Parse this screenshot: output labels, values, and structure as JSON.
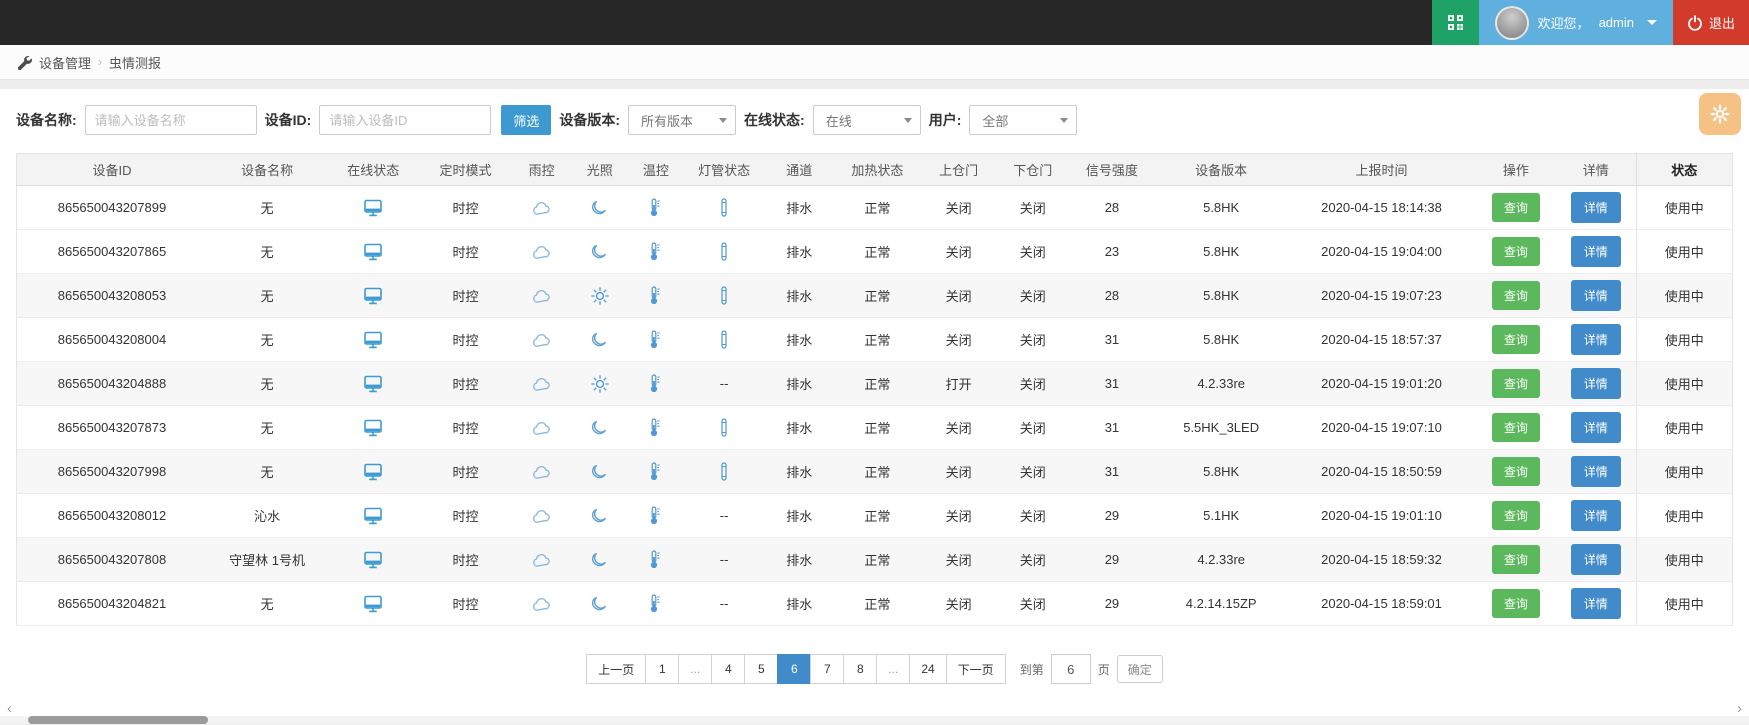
{
  "topbar": {
    "welcome_prefix": "欢迎您，",
    "username": "admin",
    "logout_label": "退出"
  },
  "breadcrumb": {
    "items": [
      "设备管理",
      "虫情测报"
    ],
    "separator": "›"
  },
  "filters": {
    "device_name_label": "设备名称:",
    "device_name_placeholder": "请输入设备名称",
    "device_id_label": "设备ID:",
    "device_id_placeholder": "请输入设备ID",
    "filter_button_label": "筛选",
    "version_label": "设备版本:",
    "version_value": "所有版本",
    "online_label": "在线状态:",
    "online_value": "在线",
    "user_label": "用户:",
    "user_value": "全部"
  },
  "table": {
    "headers": [
      "设备ID",
      "设备名称",
      "在线状态",
      "定时模式",
      "雨控",
      "光照",
      "温控",
      "灯管状态",
      "通道",
      "加热状态",
      "上仓门",
      "下仓门",
      "信号强度",
      "设备版本",
      "上报时间",
      "操作",
      "详情",
      "状态"
    ],
    "rows": [
      {
        "device_id": "865650043207899",
        "name": "无",
        "online": "monitor-icon",
        "timer_mode": "时控",
        "rain": "cloud-icon",
        "light": "moon-icon",
        "temp": "thermometer-icon",
        "tube": "tube-icon",
        "channel": "排水",
        "heating": "正常",
        "upper_door": "关闭",
        "lower_door": "关闭",
        "signal": "28",
        "version": "5.8HK",
        "report_time": "2020-04-15 18:14:38",
        "query": "查询",
        "detail": "详情",
        "status": "使用中"
      },
      {
        "device_id": "865650043207865",
        "name": "无",
        "online": "monitor-icon",
        "timer_mode": "时控",
        "rain": "cloud-icon",
        "light": "moon-icon",
        "temp": "thermometer-icon",
        "tube": "tube-icon",
        "channel": "排水",
        "heating": "正常",
        "upper_door": "关闭",
        "lower_door": "关闭",
        "signal": "23",
        "version": "5.8HK",
        "report_time": "2020-04-15 19:04:00",
        "query": "查询",
        "detail": "详情",
        "status": "使用中"
      },
      {
        "device_id": "865650043208053",
        "name": "无",
        "online": "monitor-icon",
        "timer_mode": "时控",
        "rain": "cloud-icon",
        "light": "sun-icon",
        "temp": "thermometer-icon",
        "tube": "tube-icon",
        "channel": "排水",
        "heating": "正常",
        "upper_door": "关闭",
        "lower_door": "关闭",
        "signal": "28",
        "version": "5.8HK",
        "report_time": "2020-04-15 19:07:23",
        "query": "查询",
        "detail": "详情",
        "status": "使用中"
      },
      {
        "device_id": "865650043208004",
        "name": "无",
        "online": "monitor-icon",
        "timer_mode": "时控",
        "rain": "cloud-icon",
        "light": "moon-icon",
        "temp": "thermometer-icon",
        "tube": "tube-icon",
        "channel": "排水",
        "heating": "正常",
        "upper_door": "关闭",
        "lower_door": "关闭",
        "signal": "31",
        "version": "5.8HK",
        "report_time": "2020-04-15 18:57:37",
        "query": "查询",
        "detail": "详情",
        "status": "使用中"
      },
      {
        "device_id": "865650043204888",
        "name": "无",
        "online": "monitor-icon",
        "timer_mode": "时控",
        "rain": "cloud-icon",
        "light": "sun-icon",
        "temp": "thermometer-icon",
        "tube": "--",
        "channel": "排水",
        "heating": "正常",
        "upper_door": "打开",
        "lower_door": "关闭",
        "signal": "31",
        "version": "4.2.33re",
        "report_time": "2020-04-15 19:01:20",
        "query": "查询",
        "detail": "详情",
        "status": "使用中"
      },
      {
        "device_id": "865650043207873",
        "name": "无",
        "online": "monitor-icon",
        "timer_mode": "时控",
        "rain": "cloud-icon",
        "light": "moon-icon",
        "temp": "thermometer-icon",
        "tube": "tube-icon",
        "channel": "排水",
        "heating": "正常",
        "upper_door": "关闭",
        "lower_door": "关闭",
        "signal": "31",
        "version": "5.5HK_3LED",
        "report_time": "2020-04-15 19:07:10",
        "query": "查询",
        "detail": "详情",
        "status": "使用中"
      },
      {
        "device_id": "865650043207998",
        "name": "无",
        "online": "monitor-icon",
        "timer_mode": "时控",
        "rain": "cloud-icon",
        "light": "moon-icon",
        "temp": "thermometer-icon",
        "tube": "tube-icon",
        "channel": "排水",
        "heating": "正常",
        "upper_door": "关闭",
        "lower_door": "关闭",
        "signal": "31",
        "version": "5.8HK",
        "report_time": "2020-04-15 18:50:59",
        "query": "查询",
        "detail": "详情",
        "status": "使用中"
      },
      {
        "device_id": "865650043208012",
        "name": "沁水",
        "online": "monitor-icon",
        "timer_mode": "时控",
        "rain": "cloud-icon",
        "light": "moon-icon",
        "temp": "thermometer-icon",
        "tube": "--",
        "channel": "排水",
        "heating": "正常",
        "upper_door": "关闭",
        "lower_door": "关闭",
        "signal": "29",
        "version": "5.1HK",
        "report_time": "2020-04-15 19:01:10",
        "query": "查询",
        "detail": "详情",
        "status": "使用中"
      },
      {
        "device_id": "865650043207808",
        "name": "守望林 1号机",
        "online": "monitor-icon",
        "timer_mode": "时控",
        "rain": "cloud-icon",
        "light": "moon-icon",
        "temp": "thermometer-icon",
        "tube": "--",
        "channel": "排水",
        "heating": "正常",
        "upper_door": "关闭",
        "lower_door": "关闭",
        "signal": "29",
        "version": "4.2.33re",
        "report_time": "2020-04-15 18:59:32",
        "query": "查询",
        "detail": "详情",
        "status": "使用中"
      },
      {
        "device_id": "865650043204821",
        "name": "无",
        "online": "monitor-icon",
        "timer_mode": "时控",
        "rain": "cloud-icon",
        "light": "moon-icon",
        "temp": "thermometer-icon",
        "tube": "--",
        "channel": "排水",
        "heating": "正常",
        "upper_door": "关闭",
        "lower_door": "关闭",
        "signal": "29",
        "version": "4.2.14.15ZP",
        "report_time": "2020-04-15 18:59:01",
        "query": "查询",
        "detail": "详情",
        "status": "使用中"
      }
    ]
  },
  "pagination": {
    "items": [
      "上一页",
      "1",
      "...",
      "4",
      "5",
      "6",
      "7",
      "8",
      "...",
      "24",
      "下一页"
    ],
    "active": "6",
    "goto_prefix": "到第",
    "goto_value": "6",
    "goto_suffix": "页",
    "confirm_label": "确定"
  },
  "icons": {
    "online": "monitor-icon",
    "rain": "cloud-icon",
    "light_moon": "moon-icon",
    "light_sun": "sun-icon",
    "temp": "thermometer-icon",
    "tube": "tube-icon",
    "topbar_qr": "qr-code-icon",
    "logout": "power-icon",
    "breadcrumb": "wrench-icon",
    "settings_fab": "gear-icon"
  },
  "colors": {
    "topbar_bg": "#272727",
    "qr_green": "#1ea266",
    "userbar_blue": "#5fb0de",
    "logout_red": "#d23b2b",
    "filter_blue": "#3d9ad1",
    "query_green": "#5cb85c",
    "detail_blue": "#428bca",
    "active_page_blue": "#428bca",
    "gear_orange": "#f6c185",
    "icon_blue": "#4f97d5"
  }
}
